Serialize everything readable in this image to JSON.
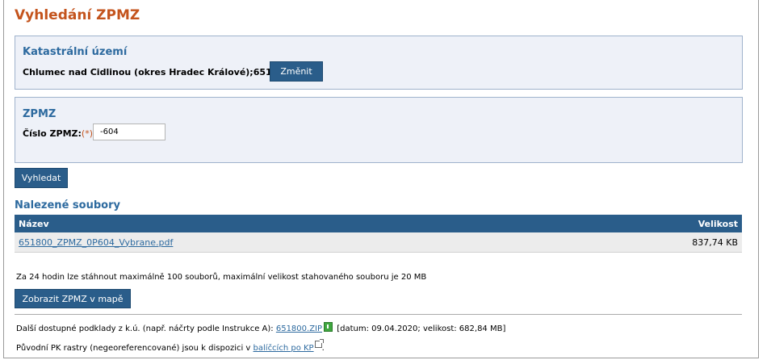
{
  "page": {
    "title": "Vyhledání ZPMZ"
  },
  "ku_box": {
    "title": "Katastrální území",
    "value": "Chlumec nad Cidlinou (okres Hradec Králové);651800",
    "change_label": "Změnit"
  },
  "zpmz_box": {
    "title": "ZPMZ",
    "field_label": "Číslo ZPMZ:",
    "required_mark": "(*)",
    "field_value": "-604"
  },
  "search_label": "Vyhledat",
  "results": {
    "title": "Nalezené soubory",
    "columns": [
      "Název",
      "Velikost"
    ],
    "rows": [
      {
        "name": "651800_ZPMZ_0P604_Vybrane.pdf",
        "size": "837,74 KB"
      }
    ]
  },
  "limit_info": "Za 24 hodin lze stáhnout maximálně 100 souborů, maximální velikost stahovaného souboru je 20 MB",
  "map_button_label": "Zobrazit ZPMZ v mapě",
  "other_docs": {
    "prefix": "Další dostupné podklady z k.ú. (např. náčrty podle Instrukce A): ",
    "link": "651800.ZIP",
    "suffix": " [datum: 09.04.2020; velikost: 682,84 MB]"
  },
  "pk_rastry": {
    "prefix": "Původní PK rastry (negeoreferencované) jsou k dispozici v ",
    "link": "balíčcích po KP",
    "suffix": "."
  },
  "icons": {
    "zip": "zip-file-icon",
    "external": "external-link-icon"
  },
  "colors": {
    "title": "#c4541d",
    "accent": "#2a5d8a",
    "section_title": "#2d6a9f",
    "box_bg": "#eef1f8"
  }
}
